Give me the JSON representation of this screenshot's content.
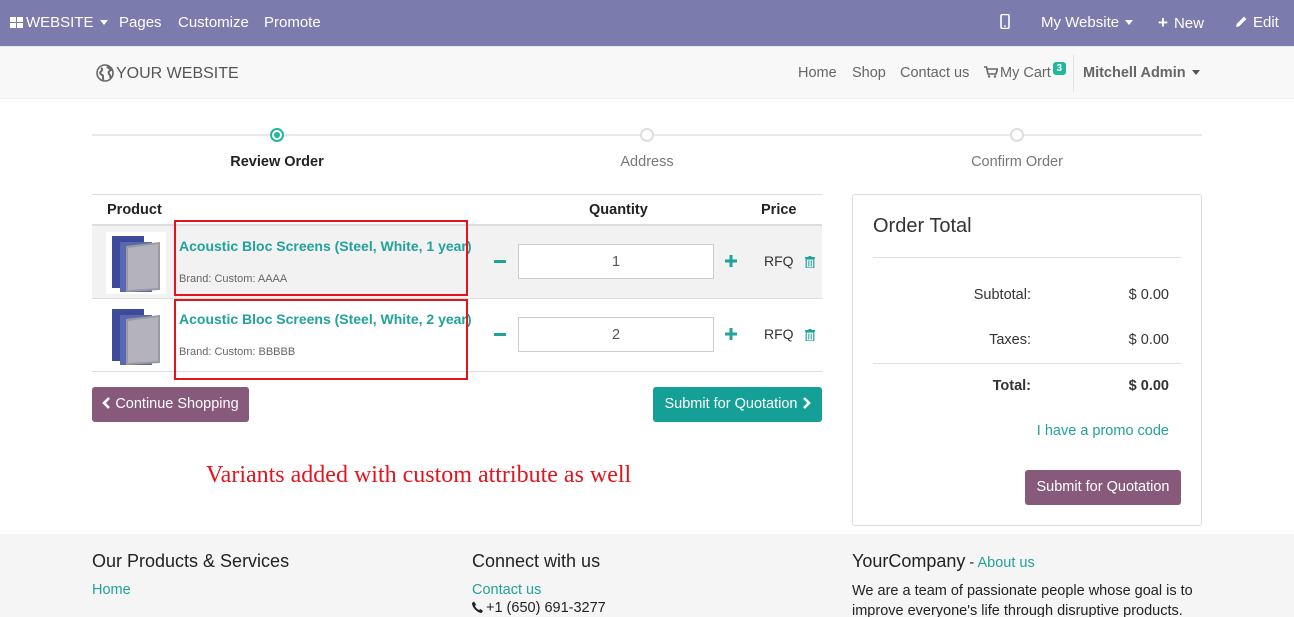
{
  "admin_bar": {
    "website_menu": "WEBSITE",
    "pages": "Pages",
    "customize": "Customize",
    "promote": "Promote",
    "my_website": "My Website",
    "new": "New",
    "edit": "Edit",
    "background_color": "#7c7bad"
  },
  "header": {
    "logo_text": "YOUR WEBSITE",
    "nav": [
      "Home",
      "Shop",
      "Contact us"
    ],
    "cart_label": "My Cart",
    "cart_count": "3",
    "user": "Mitchell Admin"
  },
  "wizard": {
    "steps": [
      "Review Order",
      "Address",
      "Confirm Order"
    ],
    "active_step": 0
  },
  "cart": {
    "columns": {
      "product": "Product",
      "quantity": "Quantity",
      "price": "Price"
    },
    "rows": [
      {
        "name": "Acoustic Bloc Screens (Steel, White, 1 year)",
        "description": "Brand: Custom: AAAA",
        "quantity": "1",
        "price": "RFQ"
      },
      {
        "name": "Acoustic Bloc Screens (Steel, White, 2 year)",
        "description": "Brand: Custom: BBBBB",
        "quantity": "2",
        "price": "RFQ"
      }
    ],
    "continue_shopping": "Continue Shopping",
    "submit_quotation": "Submit for Quotation"
  },
  "annotation": "Variants added with custom attribute as well",
  "order_total": {
    "title": "Order Total",
    "subtotal_label": "Subtotal:",
    "subtotal": "$ 0.00",
    "taxes_label": "Taxes:",
    "taxes": "$ 0.00",
    "total_label": "Total:",
    "total": "$ 0.00",
    "promo": "I have a promo code",
    "submit": "Submit for Quotation"
  },
  "footer": {
    "products_title": "Our Products & Services",
    "products_link": "Home",
    "connect_title": "Connect with us",
    "contact_link": "Contact us",
    "phone": "+1 (650) 691-3277",
    "company_name": "YourCompany",
    "company_sep": " - ",
    "about_link": "About us",
    "company_text": "We are a team of passionate people whose goal is to improve everyone's life through disruptive products. We"
  },
  "colors": {
    "accent_teal": "#21a29a",
    "primary_purple": "#875a7b",
    "highlight_red": "#e3141e"
  }
}
